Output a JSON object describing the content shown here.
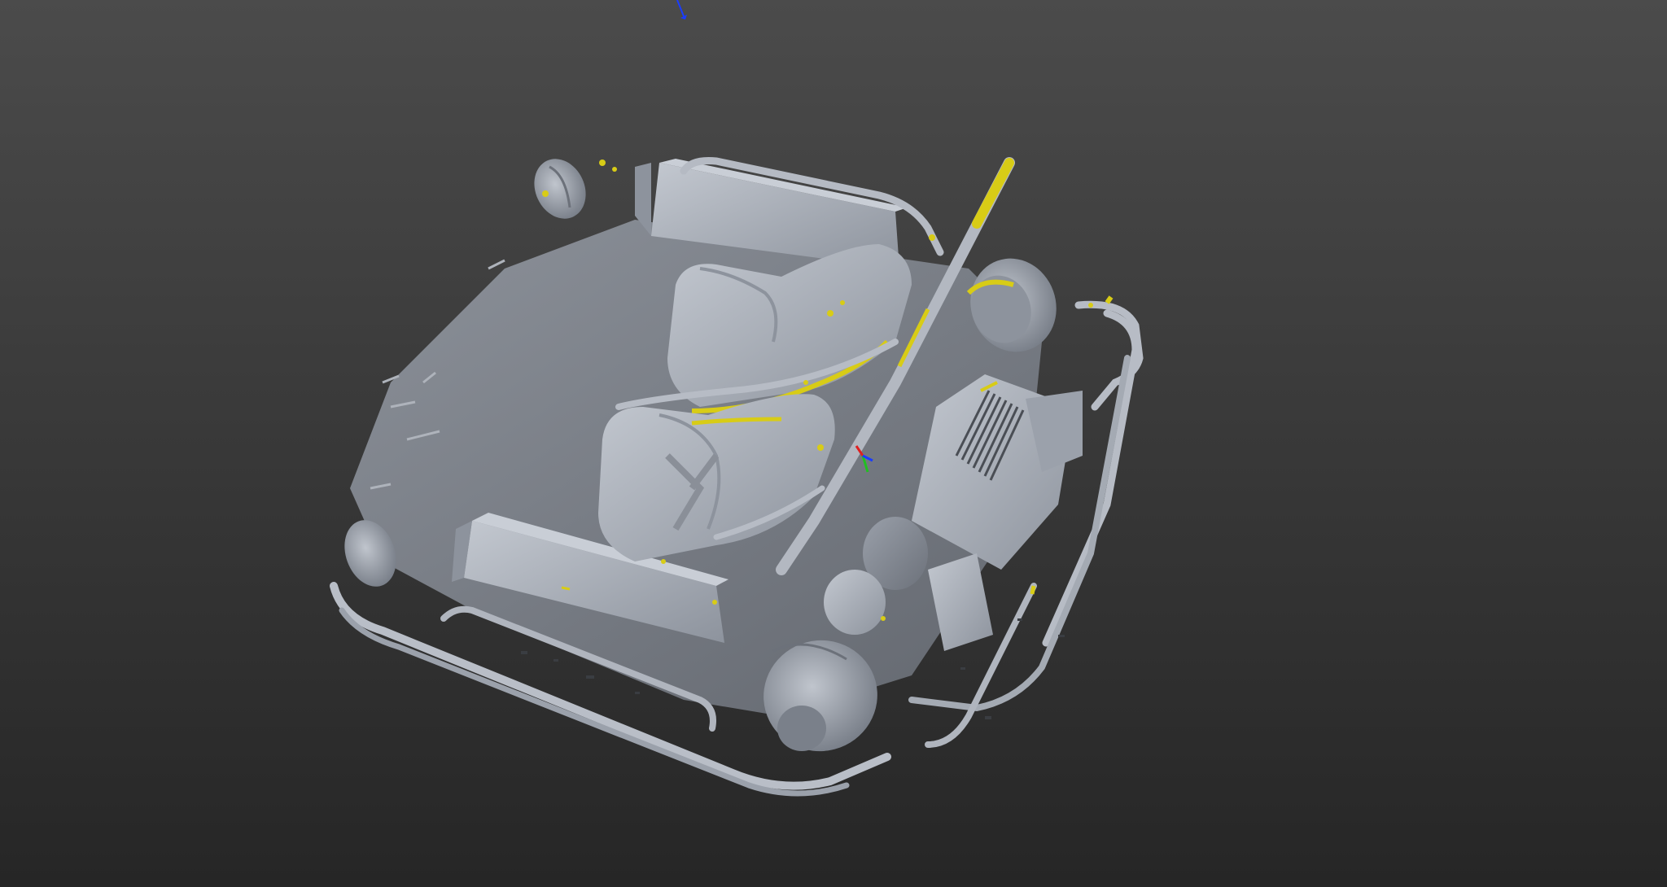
{
  "viewport": {
    "background_top_color": "#4b4b4b",
    "background_bottom_color": "#262626"
  },
  "model": {
    "name": "go-kart-3d-scan",
    "surface_color": "#a7adb8",
    "shade_color": "#7d838e",
    "dark_color": "#4a4e55",
    "highlight_color": "#c9ced6",
    "deviation_color": "#d8cc16"
  },
  "gizmo": {
    "x_axis_color": "#e02020",
    "y_axis_color": "#20c020",
    "z_axis_color": "#1a3cff"
  }
}
